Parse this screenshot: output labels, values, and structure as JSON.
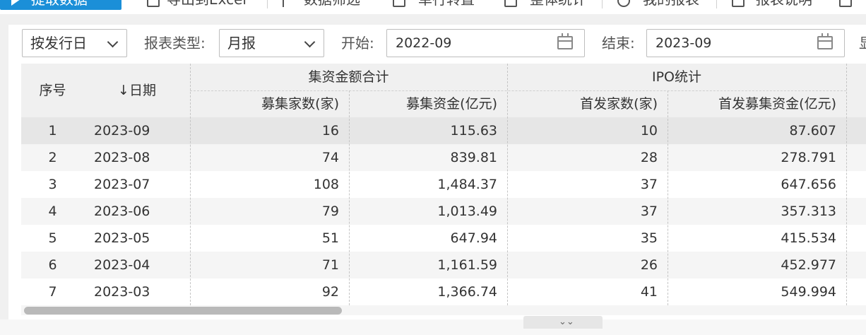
{
  "toolbar": {
    "primary_label": "提取数据",
    "items": [
      "导出到Excel",
      "数据筛选",
      "单行转置",
      "整体统计",
      "我的报表",
      "报表说明"
    ]
  },
  "filters": {
    "date_type": "按发行日",
    "report_type_label": "报表类型:",
    "report_type_value": "月报",
    "start_label": "开始:",
    "start_value": "2022-09",
    "end_label": "结束:",
    "end_value": "2023-09",
    "extra_label": "显"
  },
  "table": {
    "col_index": "序号",
    "col_date": "↓日期",
    "group1": "集资金额合计",
    "group2": "IPO统计",
    "col_g1_count": "募集家数(家)",
    "col_g1_amount": "募集资金(亿元)",
    "col_g2_count": "首发家数(家)",
    "col_g2_amount": "首发募集资金(亿元)",
    "rows": [
      {
        "idx": "1",
        "date": "2023-09",
        "count": "16",
        "amount": "115.63",
        "ipo_count": "10",
        "ipo_amount": "87.607"
      },
      {
        "idx": "2",
        "date": "2023-08",
        "count": "74",
        "amount": "839.81",
        "ipo_count": "28",
        "ipo_amount": "278.791"
      },
      {
        "idx": "3",
        "date": "2023-07",
        "count": "108",
        "amount": "1,484.37",
        "ipo_count": "37",
        "ipo_amount": "647.656"
      },
      {
        "idx": "4",
        "date": "2023-06",
        "count": "79",
        "amount": "1,013.49",
        "ipo_count": "37",
        "ipo_amount": "357.313"
      },
      {
        "idx": "5",
        "date": "2023-05",
        "count": "51",
        "amount": "647.94",
        "ipo_count": "35",
        "ipo_amount": "415.534"
      },
      {
        "idx": "6",
        "date": "2023-04",
        "count": "71",
        "amount": "1,161.59",
        "ipo_count": "26",
        "ipo_amount": "452.977"
      },
      {
        "idx": "7",
        "date": "2023-03",
        "count": "92",
        "amount": "1,366.74",
        "ipo_count": "41",
        "ipo_amount": "549.994"
      }
    ]
  },
  "expand_glyph": "⌄⌄",
  "colors": {
    "accent": "#1b8fd8",
    "header_bg": "#f0f0f0",
    "selected_row": "#e6e6e6",
    "alt_row": "#f5f5f5"
  }
}
